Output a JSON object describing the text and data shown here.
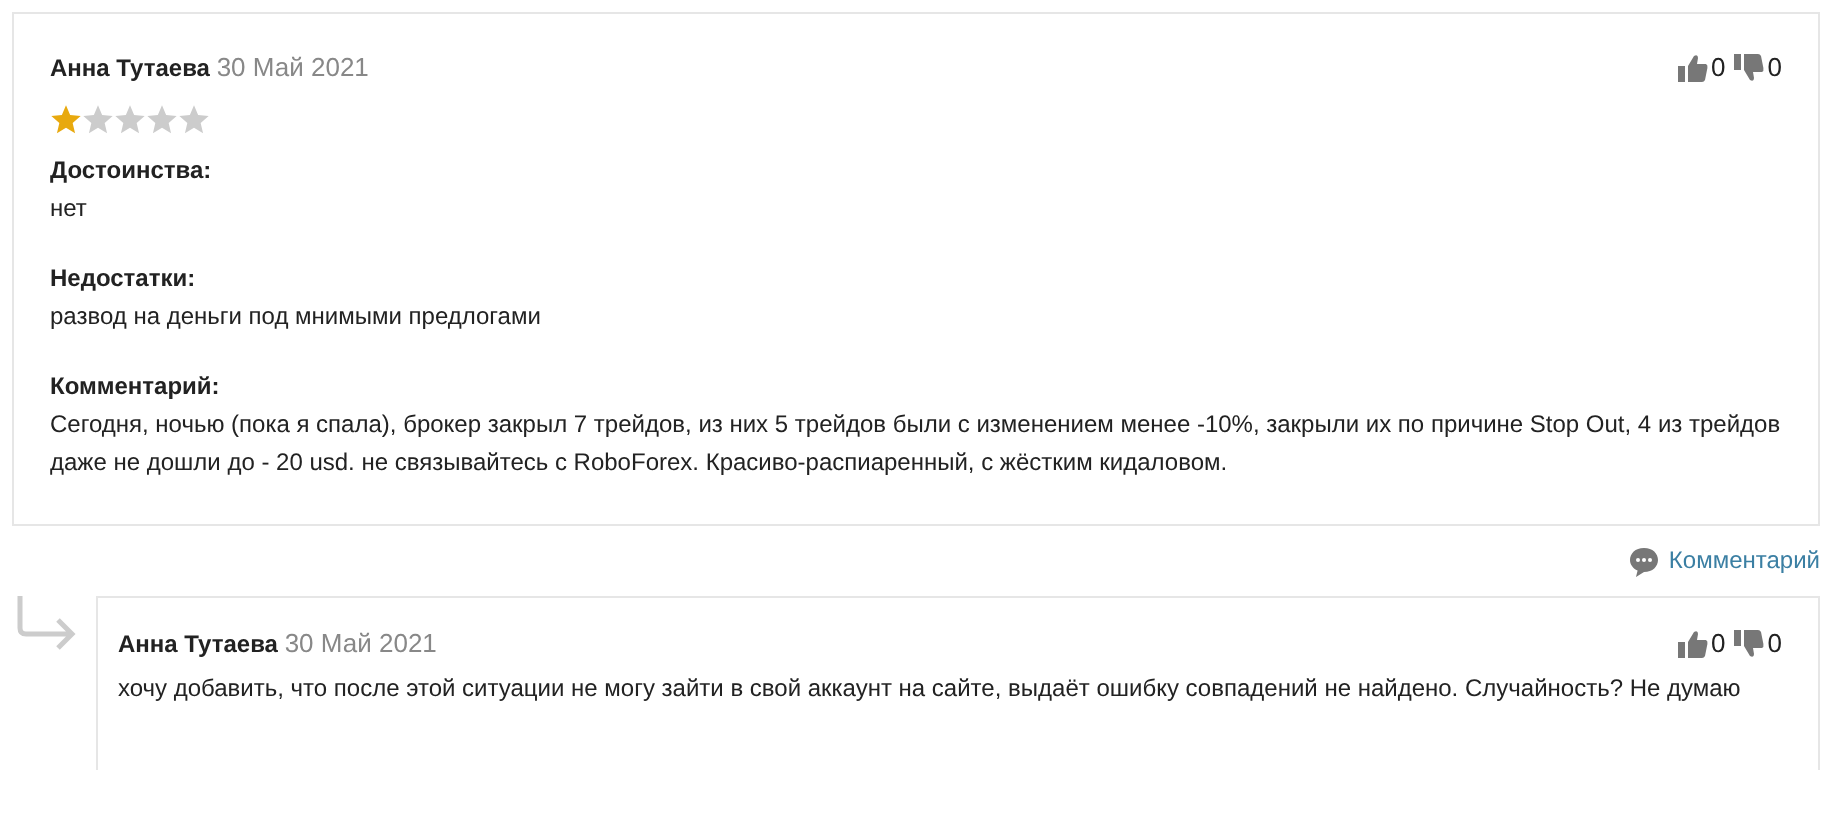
{
  "review": {
    "author": "Анна Тутаева",
    "date": "30 Май 2021",
    "stars": 1,
    "likes": "0",
    "dislikes": "0",
    "sections": [
      {
        "heading": "Достоинства:",
        "text": "нет"
      },
      {
        "heading": "Недостатки:",
        "text": "развод на деньги под мнимыми предлогами"
      },
      {
        "heading": "Комментарий:",
        "text": "Сегодня, ночью (пока я спала), брокер закрыл 7 трейдов, из них 5 трейдов были с изменением менее -10%, закрыли их по причине Stop Out, 4 из трейдов даже не дошли до - 20 usd. не связывайтесь с RoboForex. Красиво-распиаренный, с жёстким кидаловом."
      }
    ]
  },
  "comment_link": "Комментарий",
  "reply": {
    "author": "Анна Тутаева",
    "date": "30 Май 2021",
    "likes": "0",
    "dislikes": "0",
    "text": "хочу добавить, что после этой ситуации не могу зайти в свой аккаунт на сайте, выдаёт ошибку совпадений не найдено. Случайность? Не думаю"
  }
}
